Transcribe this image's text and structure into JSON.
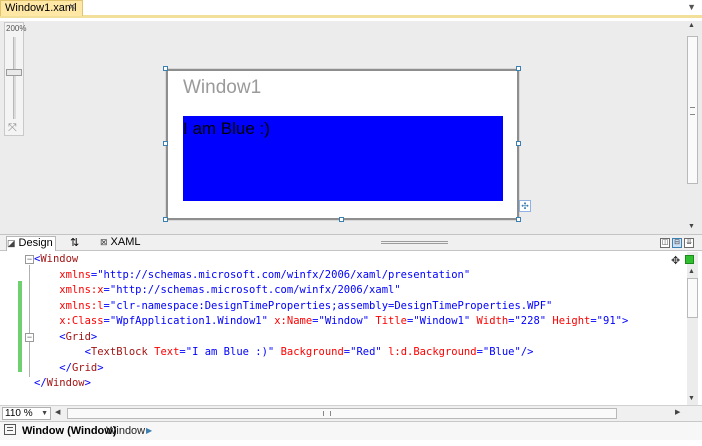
{
  "tab": {
    "title": "Window1.xaml",
    "close_glyph": "×",
    "overflow_icon": "chevron-down-icon"
  },
  "designer": {
    "zoom_top_label": "200%",
    "window_title": "Window1",
    "textblock_text": "I am Blue :)",
    "textblock_background": "#0000ff"
  },
  "splitbar": {
    "design_tab": "Design",
    "swap_tab": "⇅",
    "xaml_tab": "XAML"
  },
  "editor": {
    "lines": [
      {
        "parts": [
          {
            "c": "c-bl",
            "t": "<"
          },
          {
            "c": "c-mr",
            "t": "Window"
          }
        ]
      },
      {
        "parts": [
          {
            "c": "c-rd",
            "t": "    xmlns"
          },
          {
            "c": "c-bl",
            "t": "=\"http://schemas.microsoft.com/winfx/2006/xaml/presentation\""
          }
        ]
      },
      {
        "parts": [
          {
            "c": "c-rd",
            "t": "    xmlns:x"
          },
          {
            "c": "c-bl",
            "t": "=\"http://schemas.microsoft.com/winfx/2006/xaml\""
          }
        ]
      },
      {
        "parts": [
          {
            "c": "c-rd",
            "t": "    xmlns:l"
          },
          {
            "c": "c-bl",
            "t": "=\"clr-namespace:DesignTimeProperties;assembly=DesignTimeProperties.WPF\""
          }
        ]
      },
      {
        "parts": [
          {
            "c": "c-rd",
            "t": "    x:Class"
          },
          {
            "c": "c-bl",
            "t": "=\"WpfApplication1.Window1\" "
          },
          {
            "c": "c-rd",
            "t": "x:Name"
          },
          {
            "c": "c-bl",
            "t": "=\"Window\" "
          },
          {
            "c": "c-rd",
            "t": "Title"
          },
          {
            "c": "c-bl",
            "t": "=\"Window1\" "
          },
          {
            "c": "c-rd",
            "t": "Width"
          },
          {
            "c": "c-bl",
            "t": "=\"228\" "
          },
          {
            "c": "c-rd",
            "t": "Height"
          },
          {
            "c": "c-bl",
            "t": "=\"91\">"
          }
        ]
      },
      {
        "parts": [
          {
            "c": "c-bl",
            "t": "    <"
          },
          {
            "c": "c-mr",
            "t": "Grid"
          },
          {
            "c": "c-bl",
            "t": ">"
          }
        ]
      },
      {
        "parts": [
          {
            "c": "c-bl",
            "t": "        <"
          },
          {
            "c": "c-mr",
            "t": "TextBlock "
          },
          {
            "c": "c-rd",
            "t": "Text"
          },
          {
            "c": "c-bl",
            "t": "=\"I am Blue :)\" "
          },
          {
            "c": "c-rd",
            "t": "Background"
          },
          {
            "c": "c-bl",
            "t": "=\"Red\" "
          },
          {
            "c": "c-rd",
            "t": "l:d.Background"
          },
          {
            "c": "c-bl",
            "t": "=\"Blue\"/>"
          }
        ]
      },
      {
        "parts": [
          {
            "c": "c-bl",
            "t": "    </"
          },
          {
            "c": "c-mr",
            "t": "Grid"
          },
          {
            "c": "c-bl",
            "t": ">"
          }
        ]
      },
      {
        "parts": [
          {
            "c": "c-bl",
            "t": "</"
          },
          {
            "c": "c-mr",
            "t": "Window"
          },
          {
            "c": "c-bl",
            "t": ">"
          }
        ]
      }
    ]
  },
  "zoom": {
    "value": "110 %"
  },
  "status": {
    "active_crumb": "Window (Window)",
    "next_crumb": "Window"
  }
}
